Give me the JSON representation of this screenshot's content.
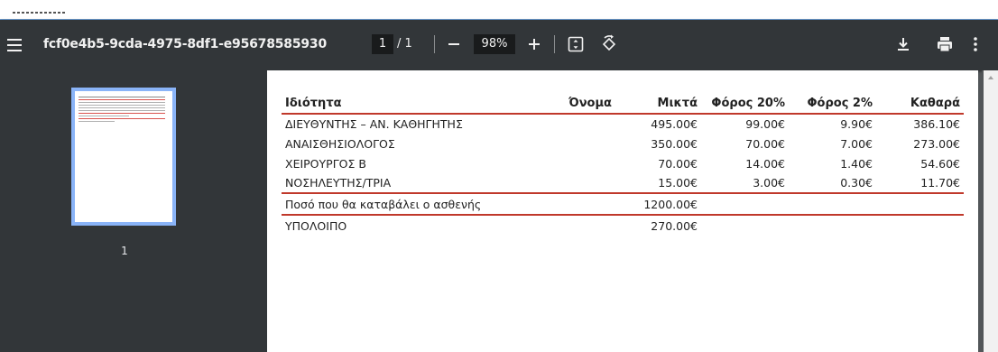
{
  "toolbar": {
    "title": "fcf0e4b5-9cda-4975-8df1-e95678585930",
    "current_page": "1",
    "page_separator": "/",
    "total_pages": "1",
    "zoom": "98%",
    "icons": [
      "menu-icon",
      "zoom-out-icon",
      "zoom-in-icon",
      "fit-page-icon",
      "rotate-icon",
      "download-icon",
      "print-icon",
      "more-vert-icon"
    ]
  },
  "sidebar": {
    "thumbnail_page_number": "1"
  },
  "table": {
    "headers": [
      "Ιδιότητα",
      "Όνομα",
      "Μικτά",
      "Φόρος 20%",
      "Φόρος 2%",
      "Καθαρά"
    ],
    "rows": [
      [
        "ΔΙΕΥΘΥΝΤΗΣ – ΑΝ. ΚΑΘΗΓΗΤΗΣ",
        "",
        "495.00€",
        "99.00€",
        "9.90€",
        "386.10€"
      ],
      [
        "ΑΝΑΙΣΘΗΣΙΟΛΟΓΟΣ",
        "",
        "350.00€",
        "70.00€",
        "7.00€",
        "273.00€"
      ],
      [
        "ΧΕΙΡΟΥΡΓΟΣ Β",
        "",
        "70.00€",
        "14.00€",
        "1.40€",
        "54.60€"
      ],
      [
        "ΝΟΣΗΛΕΥΤΗΣ/ΤΡΙΑ",
        "",
        "15.00€",
        "3.00€",
        "0.30€",
        "11.70€"
      ]
    ],
    "patient_amount_label": "Ποσό που θα καταβάλει ο ασθενής",
    "patient_amount_value": "1200.00€",
    "remainder_label": "ΥΠΟΛΟΙΠΟ",
    "remainder_value": "270.00€"
  },
  "colors": {
    "toolbar_bg": "#323639",
    "viewer_bg": "#525659",
    "thumbnail_border": "#8ab4f8",
    "table_rule": "#c0392b"
  }
}
